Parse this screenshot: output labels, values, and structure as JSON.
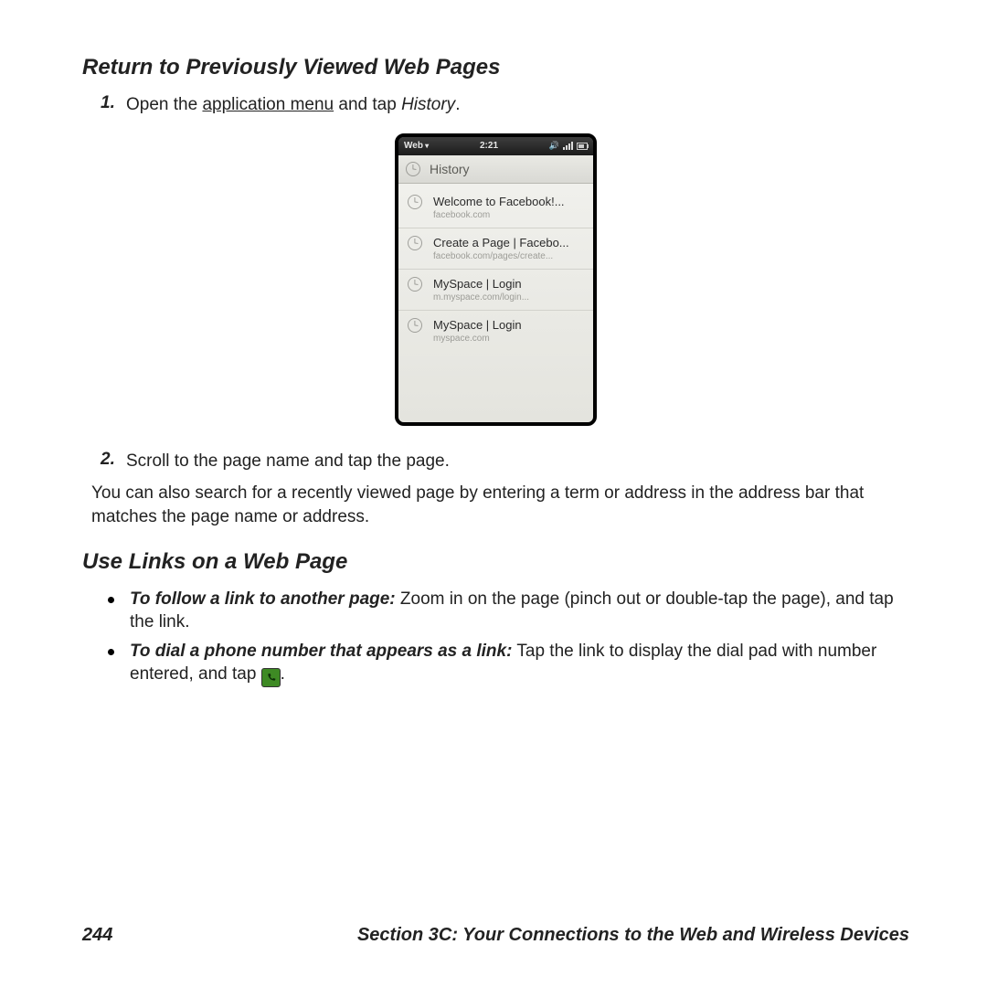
{
  "section1": {
    "heading": "Return to Previously Viewed Web Pages",
    "step1_num": "1.",
    "step1_a": "Open the ",
    "step1_link": "application menu",
    "step1_b": " and tap ",
    "step1_c": "History",
    "step1_d": ".",
    "step2_num": "2.",
    "step2_text": "Scroll to the page name and tap the page.",
    "para": "You can also search for a recently viewed page by entering a term or address in the address bar that matches the page name or address."
  },
  "screenshot": {
    "status_app": "Web",
    "status_time": "2:21",
    "title": "History",
    "items": [
      {
        "title": "Welcome to Facebook!...",
        "url": "facebook.com"
      },
      {
        "title": "Create a Page | Facebo...",
        "url": "facebook.com/pages/create..."
      },
      {
        "title": "MySpace | Login",
        "url": "m.myspace.com/login..."
      },
      {
        "title": "MySpace | Login",
        "url": "myspace.com"
      }
    ]
  },
  "section2": {
    "heading": "Use Links on a Web Page",
    "b1_lead": "To follow a link to another page:",
    "b1_rest": " Zoom in on the page (pinch out or double-tap the page), and tap the link.",
    "b2_lead": "To dial a phone number that appears as a link:",
    "b2_rest_a": " Tap the link to display the dial pad with number entered, and tap ",
    "b2_rest_b": "."
  },
  "footer": {
    "page": "244",
    "section": "Section 3C: Your Connections to the Web and Wireless Devices"
  }
}
